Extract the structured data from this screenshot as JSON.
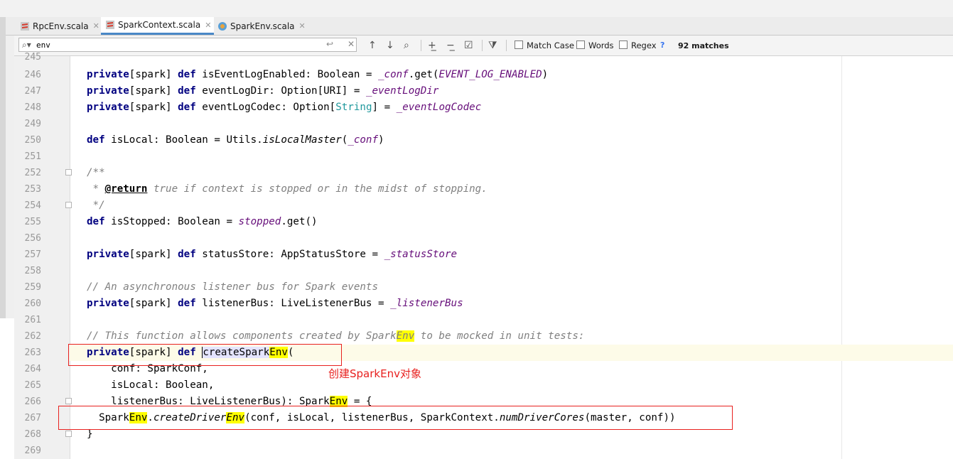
{
  "tabs": [
    {
      "label": "RpcEnv.scala",
      "icon": "scala-file-icon",
      "active": false
    },
    {
      "label": "SparkContext.scala",
      "icon": "scala-file-icon",
      "active": true
    },
    {
      "label": "SparkEnv.scala",
      "icon": "scala-object-icon",
      "active": false
    }
  ],
  "tab_close": "✕",
  "search": {
    "value": "env",
    "match_case": "Match Case",
    "words": "Words",
    "regex": "Regex",
    "help": "?",
    "matches": "92 matches"
  },
  "line_numbers": [
    "245",
    "246",
    "247",
    "248",
    "249",
    "250",
    "251",
    "252",
    "253",
    "254",
    "255",
    "256",
    "257",
    "258",
    "259",
    "260",
    "261",
    "262",
    "263",
    "264",
    "265",
    "266",
    "267",
    "268",
    "269"
  ],
  "code": {
    "l246": {
      "kw1": "private",
      "mid": "[spark] ",
      "kw2": "def",
      "rest": " isEventLogEnabled: Boolean = ",
      "it": "_conf",
      "rest2": ".get(",
      "pu": "EVENT_LOG_ENABLED",
      "end": ")"
    },
    "l247": {
      "kw1": "private",
      "mid": "[spark] ",
      "kw2": "def",
      "rest": " eventLogDir: Option[URI] = ",
      "pu": "_eventLogDir"
    },
    "l248": {
      "kw1": "private",
      "mid": "[spark] ",
      "kw2": "def",
      "rest": " eventLogCodec: Option[",
      "ty": "String",
      "rest2": "] = ",
      "pu": "_eventLogCodec"
    },
    "l250": {
      "kw": "def",
      "rest": " isLocal: Boolean = Utils.",
      "it": "isLocalMaster",
      "rest2": "(",
      "pu": "_conf",
      "end": ")"
    },
    "l252": "/**",
    "l253": {
      "pre": " * ",
      "tag": "@return",
      "post": " true if context is stopped or in the midst of stopping."
    },
    "l254": " */",
    "l255": {
      "kw": "def",
      "rest": " isStopped: Boolean = ",
      "pu": "stopped",
      "end": ".get()"
    },
    "l257": {
      "kw1": "private",
      "mid": "[spark] ",
      "kw2": "def",
      "rest": " statusStore: AppStatusStore = ",
      "pu": "_statusStore"
    },
    "l259": "// An asynchronous listener bus for Spark events",
    "l260": {
      "kw1": "private",
      "mid": "[spark] ",
      "kw2": "def",
      "rest": " listenerBus: LiveListenerBus = ",
      "pu": "_listenerBus"
    },
    "l262": {
      "pre": "// This function allows components created by Spark",
      "hl": "Env",
      "post": " to be mocked in unit tests:"
    },
    "l263": {
      "kw1": "private",
      "mid": "[spark] ",
      "kw2": "def",
      "sp": " ",
      "name1": "createSpark",
      "hl": "Env",
      "end": "("
    },
    "l264": "    conf: SparkConf,",
    "l265": "    isLocal: Boolean,",
    "l266": {
      "pre": "    listenerBus: LiveListenerBus): Spark",
      "hl": "Env",
      "post": " = {"
    },
    "l267": {
      "pre": "  Spark",
      "hl1": "Env",
      "dot": ".",
      "it1": "createDriver",
      "hl2": "Env",
      "mid": "(conf, isLocal, listenerBus, SparkContext.",
      "it2": "numDriverCores",
      "end": "(master, conf))"
    },
    "l268": "}"
  },
  "annotation": "创建SparkEnv对象",
  "colors": {
    "keyword": "#000080",
    "field": "#660e7a",
    "comment": "#808080",
    "type": "#20999d",
    "highlight": "#ffff00",
    "annotation": "#e8211f"
  }
}
